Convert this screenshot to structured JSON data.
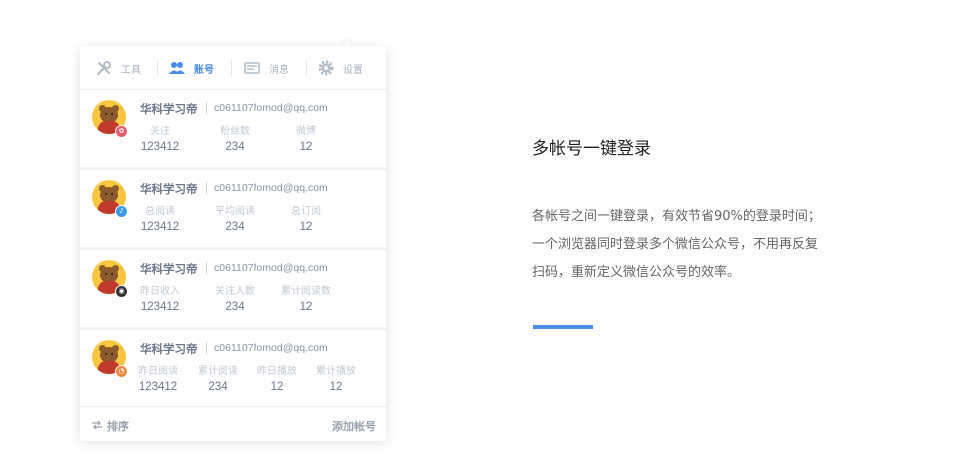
{
  "tabs": [
    {
      "label": "工具",
      "icon": "tools-icon"
    },
    {
      "label": "账号",
      "icon": "users-icon",
      "active": true
    },
    {
      "label": "消息",
      "icon": "message-icon"
    },
    {
      "label": "设置",
      "icon": "gear-icon"
    }
  ],
  "accounts": [
    {
      "name": "华科学习帝",
      "email": "c061107fomod@qq.com",
      "badge_color": "#e85b6b",
      "badge_icon": "weibo-icon",
      "badge_glyph": "✿",
      "stats": [
        {
          "label": "关注",
          "value": "123412"
        },
        {
          "label": "粉丝数",
          "value": "234"
        },
        {
          "label": "微博",
          "value": "12"
        }
      ]
    },
    {
      "name": "华科学习帝",
      "email": "c061107fomod@qq.com",
      "badge_color": "#3d9be9",
      "badge_icon": "blog-icon",
      "badge_glyph": "♪",
      "stats": [
        {
          "label": "总阅读",
          "value": "123412"
        },
        {
          "label": "平均阅读",
          "value": "234"
        },
        {
          "label": "总订阅",
          "value": "12"
        }
      ]
    },
    {
      "name": "华科学习帝",
      "email": "c061107fomod@qq.com",
      "badge_color": "#333333",
      "badge_icon": "camera-icon",
      "badge_glyph": "◉",
      "stats": [
        {
          "label": "昨日收入",
          "value": "123412"
        },
        {
          "label": "关注人数",
          "value": "234"
        },
        {
          "label": "累计阅读数",
          "value": "12"
        }
      ]
    },
    {
      "name": "华科学习帝",
      "email": "c061107fomod@qq.com",
      "badge_color": "#f08a3c",
      "badge_icon": "video-icon",
      "badge_glyph": "◔",
      "stats": [
        {
          "label": "昨日阅读",
          "value": "123412"
        },
        {
          "label": "累计阅读",
          "value": "234"
        },
        {
          "label": "昨日播放",
          "value": "12"
        },
        {
          "label": "累计播放",
          "value": "12"
        }
      ]
    }
  ],
  "footer": {
    "sort_label": "排序",
    "add_label": "添加帐号"
  },
  "feature": {
    "title": "多帐号一键登录",
    "desc_line1": "各帐号之间一键登录，有效节省90%的登录时间；",
    "desc_line2": "一个浏览器同时登录多个微信公众号，不用再反复",
    "desc_line3": "扫码，重新定义微信公众号的效率。"
  },
  "colors": {
    "accent": "#4a8ce8",
    "muted": "#a9b1bd"
  }
}
